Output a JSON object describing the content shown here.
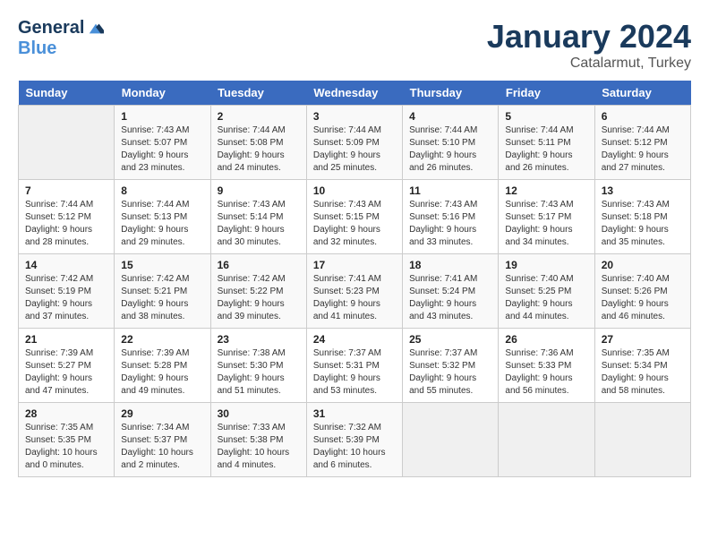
{
  "header": {
    "logo_general": "General",
    "logo_blue": "Blue",
    "month_title": "January 2024",
    "location": "Catalarmut, Turkey"
  },
  "days_of_week": [
    "Sunday",
    "Monday",
    "Tuesday",
    "Wednesday",
    "Thursday",
    "Friday",
    "Saturday"
  ],
  "weeks": [
    [
      {
        "day": "",
        "sunrise": "",
        "sunset": "",
        "daylight": ""
      },
      {
        "day": "1",
        "sunrise": "Sunrise: 7:43 AM",
        "sunset": "Sunset: 5:07 PM",
        "daylight": "Daylight: 9 hours and 23 minutes."
      },
      {
        "day": "2",
        "sunrise": "Sunrise: 7:44 AM",
        "sunset": "Sunset: 5:08 PM",
        "daylight": "Daylight: 9 hours and 24 minutes."
      },
      {
        "day": "3",
        "sunrise": "Sunrise: 7:44 AM",
        "sunset": "Sunset: 5:09 PM",
        "daylight": "Daylight: 9 hours and 25 minutes."
      },
      {
        "day": "4",
        "sunrise": "Sunrise: 7:44 AM",
        "sunset": "Sunset: 5:10 PM",
        "daylight": "Daylight: 9 hours and 26 minutes."
      },
      {
        "day": "5",
        "sunrise": "Sunrise: 7:44 AM",
        "sunset": "Sunset: 5:11 PM",
        "daylight": "Daylight: 9 hours and 26 minutes."
      },
      {
        "day": "6",
        "sunrise": "Sunrise: 7:44 AM",
        "sunset": "Sunset: 5:12 PM",
        "daylight": "Daylight: 9 hours and 27 minutes."
      }
    ],
    [
      {
        "day": "7",
        "sunrise": "Sunrise: 7:44 AM",
        "sunset": "Sunset: 5:12 PM",
        "daylight": "Daylight: 9 hours and 28 minutes."
      },
      {
        "day": "8",
        "sunrise": "Sunrise: 7:44 AM",
        "sunset": "Sunset: 5:13 PM",
        "daylight": "Daylight: 9 hours and 29 minutes."
      },
      {
        "day": "9",
        "sunrise": "Sunrise: 7:43 AM",
        "sunset": "Sunset: 5:14 PM",
        "daylight": "Daylight: 9 hours and 30 minutes."
      },
      {
        "day": "10",
        "sunrise": "Sunrise: 7:43 AM",
        "sunset": "Sunset: 5:15 PM",
        "daylight": "Daylight: 9 hours and 32 minutes."
      },
      {
        "day": "11",
        "sunrise": "Sunrise: 7:43 AM",
        "sunset": "Sunset: 5:16 PM",
        "daylight": "Daylight: 9 hours and 33 minutes."
      },
      {
        "day": "12",
        "sunrise": "Sunrise: 7:43 AM",
        "sunset": "Sunset: 5:17 PM",
        "daylight": "Daylight: 9 hours and 34 minutes."
      },
      {
        "day": "13",
        "sunrise": "Sunrise: 7:43 AM",
        "sunset": "Sunset: 5:18 PM",
        "daylight": "Daylight: 9 hours and 35 minutes."
      }
    ],
    [
      {
        "day": "14",
        "sunrise": "Sunrise: 7:42 AM",
        "sunset": "Sunset: 5:19 PM",
        "daylight": "Daylight: 9 hours and 37 minutes."
      },
      {
        "day": "15",
        "sunrise": "Sunrise: 7:42 AM",
        "sunset": "Sunset: 5:21 PM",
        "daylight": "Daylight: 9 hours and 38 minutes."
      },
      {
        "day": "16",
        "sunrise": "Sunrise: 7:42 AM",
        "sunset": "Sunset: 5:22 PM",
        "daylight": "Daylight: 9 hours and 39 minutes."
      },
      {
        "day": "17",
        "sunrise": "Sunrise: 7:41 AM",
        "sunset": "Sunset: 5:23 PM",
        "daylight": "Daylight: 9 hours and 41 minutes."
      },
      {
        "day": "18",
        "sunrise": "Sunrise: 7:41 AM",
        "sunset": "Sunset: 5:24 PM",
        "daylight": "Daylight: 9 hours and 43 minutes."
      },
      {
        "day": "19",
        "sunrise": "Sunrise: 7:40 AM",
        "sunset": "Sunset: 5:25 PM",
        "daylight": "Daylight: 9 hours and 44 minutes."
      },
      {
        "day": "20",
        "sunrise": "Sunrise: 7:40 AM",
        "sunset": "Sunset: 5:26 PM",
        "daylight": "Daylight: 9 hours and 46 minutes."
      }
    ],
    [
      {
        "day": "21",
        "sunrise": "Sunrise: 7:39 AM",
        "sunset": "Sunset: 5:27 PM",
        "daylight": "Daylight: 9 hours and 47 minutes."
      },
      {
        "day": "22",
        "sunrise": "Sunrise: 7:39 AM",
        "sunset": "Sunset: 5:28 PM",
        "daylight": "Daylight: 9 hours and 49 minutes."
      },
      {
        "day": "23",
        "sunrise": "Sunrise: 7:38 AM",
        "sunset": "Sunset: 5:30 PM",
        "daylight": "Daylight: 9 hours and 51 minutes."
      },
      {
        "day": "24",
        "sunrise": "Sunrise: 7:37 AM",
        "sunset": "Sunset: 5:31 PM",
        "daylight": "Daylight: 9 hours and 53 minutes."
      },
      {
        "day": "25",
        "sunrise": "Sunrise: 7:37 AM",
        "sunset": "Sunset: 5:32 PM",
        "daylight": "Daylight: 9 hours and 55 minutes."
      },
      {
        "day": "26",
        "sunrise": "Sunrise: 7:36 AM",
        "sunset": "Sunset: 5:33 PM",
        "daylight": "Daylight: 9 hours and 56 minutes."
      },
      {
        "day": "27",
        "sunrise": "Sunrise: 7:35 AM",
        "sunset": "Sunset: 5:34 PM",
        "daylight": "Daylight: 9 hours and 58 minutes."
      }
    ],
    [
      {
        "day": "28",
        "sunrise": "Sunrise: 7:35 AM",
        "sunset": "Sunset: 5:35 PM",
        "daylight": "Daylight: 10 hours and 0 minutes."
      },
      {
        "day": "29",
        "sunrise": "Sunrise: 7:34 AM",
        "sunset": "Sunset: 5:37 PM",
        "daylight": "Daylight: 10 hours and 2 minutes."
      },
      {
        "day": "30",
        "sunrise": "Sunrise: 7:33 AM",
        "sunset": "Sunset: 5:38 PM",
        "daylight": "Daylight: 10 hours and 4 minutes."
      },
      {
        "day": "31",
        "sunrise": "Sunrise: 7:32 AM",
        "sunset": "Sunset: 5:39 PM",
        "daylight": "Daylight: 10 hours and 6 minutes."
      },
      {
        "day": "",
        "sunrise": "",
        "sunset": "",
        "daylight": ""
      },
      {
        "day": "",
        "sunrise": "",
        "sunset": "",
        "daylight": ""
      },
      {
        "day": "",
        "sunrise": "",
        "sunset": "",
        "daylight": ""
      }
    ]
  ]
}
